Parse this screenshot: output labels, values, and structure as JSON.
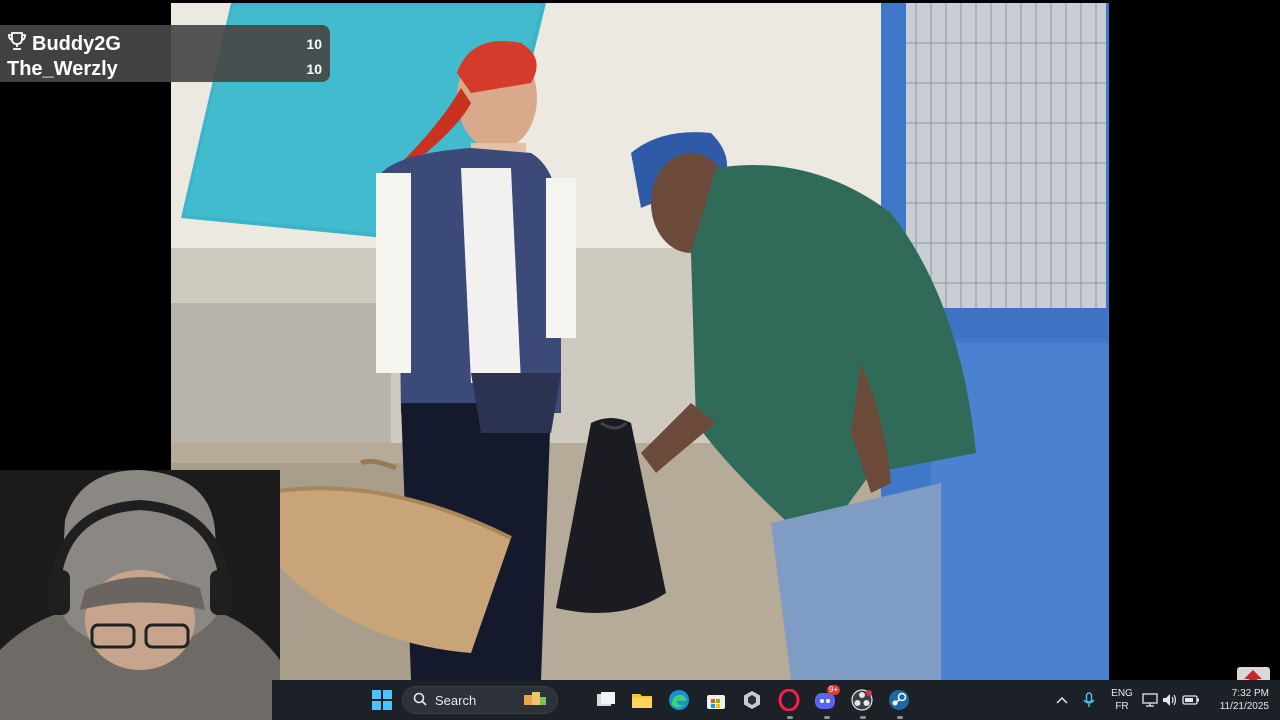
{
  "scoreboard": {
    "players": [
      {
        "name": "Buddy2G",
        "score": "10",
        "icon": "trophy-icon"
      },
      {
        "name": "The_Werzly",
        "score": "10"
      }
    ]
  },
  "video": {
    "channel_logo_text": "1",
    "channel_logo_color": "#d8141b"
  },
  "taskbar": {
    "search_placeholder": "Search",
    "apps": [
      "windows-start-icon",
      "search-icon",
      "widgets-icon",
      "task-view-icon",
      "file-explorer-icon",
      "edge-browser-icon",
      "microsoft-store-icon",
      "app-cube-icon",
      "opera-gx-icon",
      "discord-icon",
      "obs-icon",
      "steam-icon"
    ],
    "discord_badge": "9+",
    "tray": {
      "lang_top": "ENG",
      "lang_bottom": "FR",
      "time": "7:32 PM",
      "date": "11/21/2025"
    },
    "accent": "#1c2127"
  }
}
